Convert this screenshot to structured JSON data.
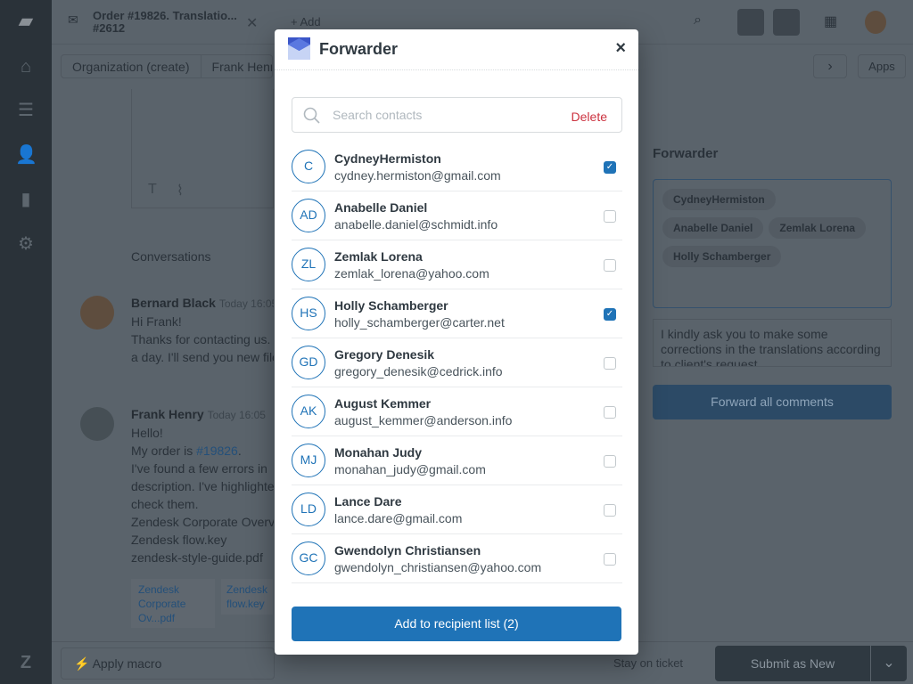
{
  "topbar": {
    "tab_title": "Order #19826. Translatio...",
    "tab_id": "#2612",
    "add_label": "+ Add"
  },
  "breadcrumb": [
    "Organization (create)",
    "Frank Henry"
  ],
  "apps_label": "Apps",
  "conversations_label": "Conversations",
  "messages": [
    {
      "author": "Bernard Black",
      "time": "Today 16:05",
      "lines": [
        "Hi Frank!",
        "Thanks for contacting us.",
        "a day. I'll send you new files"
      ]
    },
    {
      "author": "Frank Henry",
      "time": "Today 16:05",
      "lines": [
        "Hello!",
        "My order is",
        "I've found a few errors in",
        "description. I've highlighted",
        "check them.",
        "Zendesk Corporate Overview",
        "Zendesk flow.key",
        "zendesk-style-guide.pdf"
      ],
      "order_link": "#19826"
    }
  ],
  "attachments": [
    "Zendesk Corporate Ov...pdf",
    "Zendesk flow.key"
  ],
  "side_panel": {
    "title": "Forwarder",
    "pills": [
      "CydneyHermiston",
      "Anabelle Daniel",
      "Zemlak Lorena",
      "Holly Schamberger"
    ],
    "comment": "I kindly ask you to make some corrections in the translations according to client's request",
    "forward_label": "Forward all comments"
  },
  "footer": {
    "macro_label": "Apply macro",
    "stay_label": "Stay on ticket",
    "submit_label": "Submit as New"
  },
  "modal": {
    "title": "Forwarder",
    "search_placeholder": "Search contacts",
    "delete_label": "Delete",
    "contacts": [
      {
        "initials": "C",
        "name": "CydneyHermiston",
        "email": "cydney.hermiston@gmail.com",
        "checked": true
      },
      {
        "initials": "AD",
        "name": "Anabelle Daniel",
        "email": "anabelle.daniel@schmidt.info",
        "checked": false
      },
      {
        "initials": "ZL",
        "name": "Zemlak Lorena",
        "email": "zemlak_lorena@yahoo.com",
        "checked": false
      },
      {
        "initials": "HS",
        "name": "Holly Schamberger",
        "email": "holly_schamberger@carter.net",
        "checked": true
      },
      {
        "initials": "GD",
        "name": "Gregory Denesik",
        "email": "gregory_denesik@cedrick.info",
        "checked": false
      },
      {
        "initials": "AK",
        "name": "August Kemmer",
        "email": "august_kemmer@anderson.info",
        "checked": false
      },
      {
        "initials": "MJ",
        "name": "Monahan Judy",
        "email": "monahan_judy@gmail.com",
        "checked": false
      },
      {
        "initials": "LD",
        "name": "Lance Dare",
        "email": "lance.dare@gmail.com",
        "checked": false
      },
      {
        "initials": "GC",
        "name": "Gwendolyn Christiansen",
        "email": "gwendolyn_christiansen@yahoo.com",
        "checked": false
      }
    ],
    "add_label": "Add to recipient list (2)"
  },
  "colors": {
    "accent": "#1f73b7",
    "danger": "#cc3340",
    "sidebar": "#1d2830"
  }
}
